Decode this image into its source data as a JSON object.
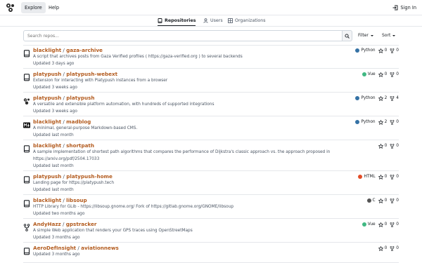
{
  "nav": {
    "explore_label": "Explore",
    "help_label": "Help",
    "signin_label": "Sign In"
  },
  "tabs": [
    {
      "label": "Repositories",
      "icon": "repo-icon",
      "active": true
    },
    {
      "label": "Users",
      "icon": "person-icon",
      "active": false
    },
    {
      "label": "Organizations",
      "icon": "organization-icon",
      "active": false
    }
  ],
  "search": {
    "placeholder": "Search repos...",
    "filter_label": "Filter",
    "sort_label": "Sort"
  },
  "colors": {
    "accent": "#b35b1e",
    "python": "#3572a5",
    "vue": "#41b883",
    "html": "#e34c26",
    "c": "#555555"
  },
  "repos": [
    {
      "owner": "blacklight",
      "name": "gaza-archive",
      "desc": "A script that archives posts from Gaza Verified profiles ( https://gaza-verified.org ) to several backends",
      "desc2": "",
      "updated": "Updated 3 days ago",
      "lang": "Python",
      "stars": "0",
      "forks": "0",
      "icon": "repo-icon"
    },
    {
      "owner": "platypush",
      "name": "platypush-webext",
      "desc": "Extension for interacting with Platypush instances from a browser",
      "desc2": "",
      "updated": "Updated 3 weeks ago",
      "lang": "Vue",
      "stars": "0",
      "forks": "0",
      "icon": "repo-icon"
    },
    {
      "owner": "platypush",
      "name": "platypush",
      "desc": "A versatile and extensible platform automation, with hundreds of supported integrations",
      "desc2": "",
      "updated": "Updated 3 weeks ago",
      "lang": "Python",
      "stars": "2",
      "forks": "4",
      "icon": "project-avatar-icon"
    },
    {
      "owner": "blacklight",
      "name": "madblog",
      "desc": "A minimal, general-purpose Markdown-based CMS.",
      "desc2": "",
      "updated": "Updated last month",
      "lang": "Python",
      "stars": "2",
      "forks": "0",
      "icon": "markdown-avatar-icon"
    },
    {
      "owner": "blacklight",
      "name": "shortpath",
      "desc": "A sample implementation of shortest path algorithms that compares the performance of Dijkstra's classic approach vs. the approach proposed in",
      "desc2": "https://arxiv.org/pdf/2504.17033",
      "updated": "Updated last month",
      "lang": "",
      "stars": "0",
      "forks": "0",
      "icon": "repo-icon"
    },
    {
      "owner": "platypush",
      "name": "platypush-home",
      "desc": "Landing page for https://platypush.tech",
      "desc2": "",
      "updated": "Updated last month",
      "lang": "HTML",
      "stars": "0",
      "forks": "0",
      "icon": "repo-icon"
    },
    {
      "owner": "blacklight",
      "name": "libsoup",
      "desc": "HTTP Library for GLib - https://libsoup.gnome.org/ Fork of https://gitlab.gnome.org/GNOME/libsoup",
      "desc2": "",
      "updated": "Updated two months ago",
      "lang": "C",
      "stars": "0",
      "forks": "0",
      "icon": "repo-icon"
    },
    {
      "owner": "AndyHazz",
      "name": "gpstracker",
      "desc": "A simple Web application that renders your GPS traces using OpenStreetMaps",
      "desc2": "",
      "updated": "Updated 3 months ago",
      "lang": "Vue",
      "stars": "0",
      "forks": "0",
      "icon": "fork-icon"
    },
    {
      "owner": "AeroDefInsight",
      "name": "aviationnews",
      "desc": "",
      "desc2": "",
      "updated": "Updated 3 months ago",
      "lang": "",
      "stars": "0",
      "forks": "0",
      "icon": "repo-icon"
    }
  ]
}
